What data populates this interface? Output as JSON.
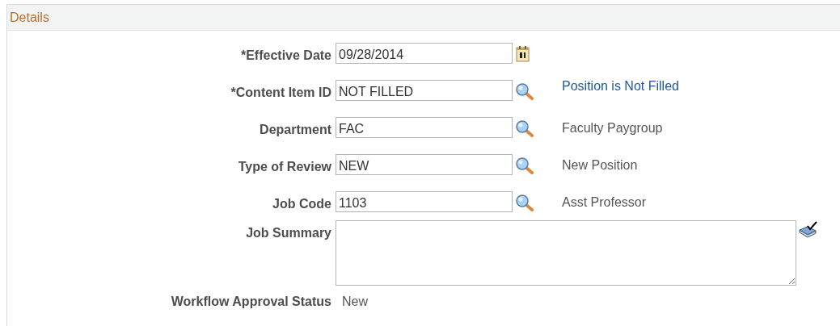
{
  "section": {
    "title": "Details"
  },
  "fields": [
    {
      "kind": "date",
      "label": "*Effective Date",
      "value": "09/28/2014"
    },
    {
      "kind": "lookup",
      "label": "*Content Item ID",
      "value": "NOT FILLED",
      "description": "Position is Not Filled",
      "link": true
    },
    {
      "kind": "lookup",
      "label": "Department",
      "value": "FAC",
      "description": "Faculty Paygroup",
      "link": false
    },
    {
      "kind": "lookup",
      "label": "Type of Review",
      "value": "NEW",
      "description": "New Position",
      "link": false
    },
    {
      "kind": "lookup",
      "label": "Job Code",
      "value": "1103",
      "description": "Asst Professor",
      "link": false
    },
    {
      "kind": "textarea",
      "label": "Job Summary"
    },
    {
      "kind": "display",
      "label": "Workflow Approval Status",
      "value": "New"
    }
  ]
}
